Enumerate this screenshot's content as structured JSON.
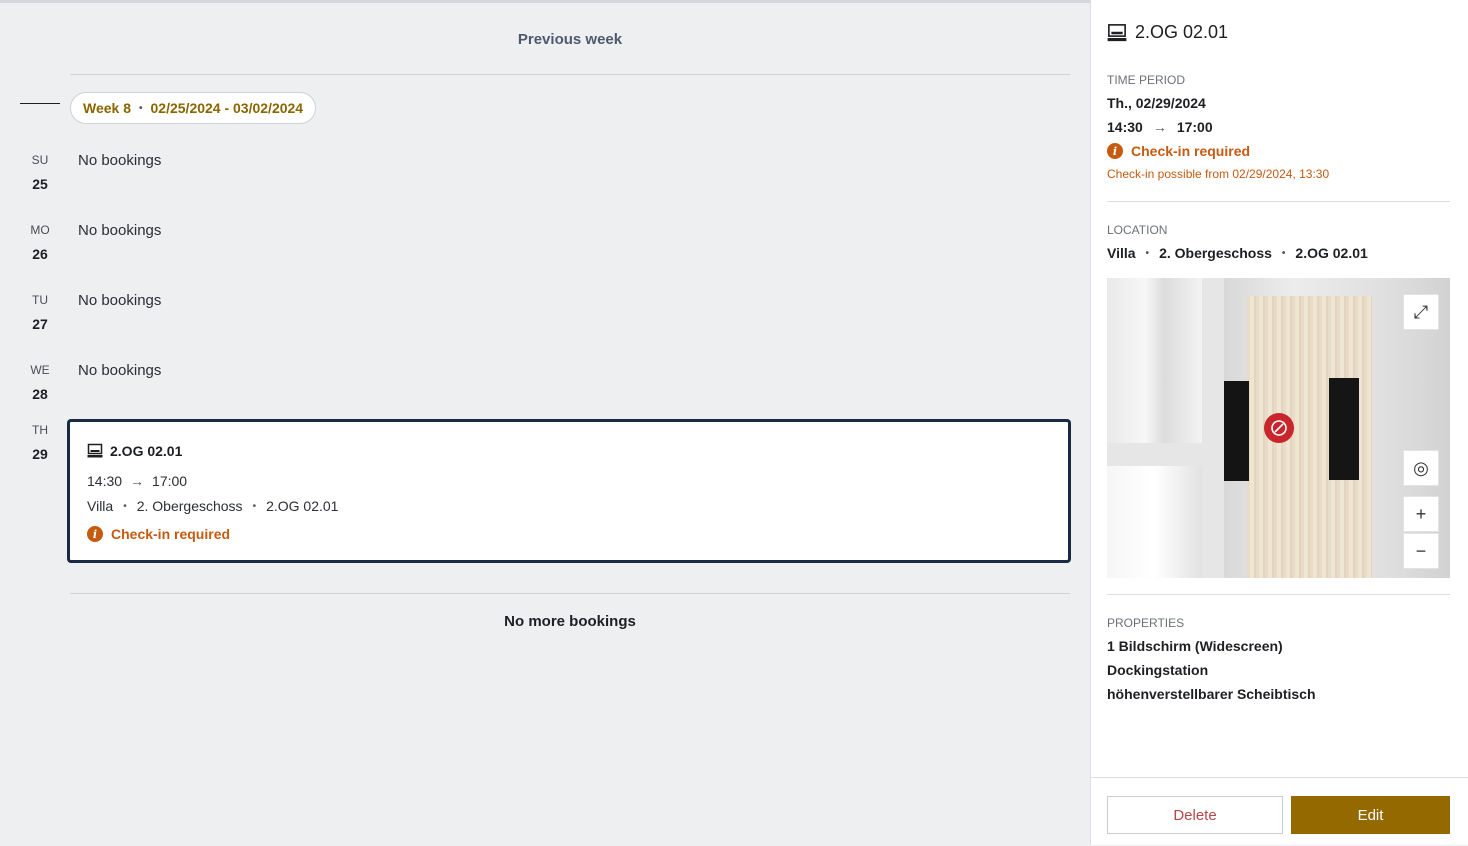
{
  "list": {
    "previous_week": "Previous week",
    "week_label": "Week 8",
    "week_range": "02/25/2024 - 03/02/2024",
    "no_bookings": "No bookings",
    "no_more": "No more bookings",
    "days": [
      {
        "wd": "SU",
        "dn": "25"
      },
      {
        "wd": "MO",
        "dn": "26"
      },
      {
        "wd": "TU",
        "dn": "27"
      },
      {
        "wd": "WE",
        "dn": "28"
      },
      {
        "wd": "TH",
        "dn": "29"
      }
    ],
    "booking": {
      "title": "2.OG 02.01",
      "start": "14:30",
      "end": "17:00",
      "loc_building": "Villa",
      "loc_floor": "2. Obergeschoss",
      "loc_desk": "2.OG 02.01",
      "checkin": "Check-in required"
    }
  },
  "details": {
    "title": "2.OG 02.01",
    "time_period_label": "TIME PERIOD",
    "date": "Th., 02/29/2024",
    "start": "14:30",
    "end": "17:00",
    "checkin": "Check-in required",
    "checkin_sub": "Check-in possible from 02/29/2024, 13:30",
    "location_label": "LOCATION",
    "loc_building": "Villa",
    "loc_floor": "2. Obergeschoss",
    "loc_desk": "2.OG 02.01",
    "properties_label": "PROPERTIES",
    "properties": [
      "1 Bildschirm (Widescreen)",
      "Dockingstation",
      "höhenverstellbarer Scheibtisch"
    ],
    "delete": "Delete",
    "edit": "Edit"
  },
  "colors": {
    "accent": "#946a00",
    "warning": "#c55a11",
    "delete": "#b8454a"
  }
}
